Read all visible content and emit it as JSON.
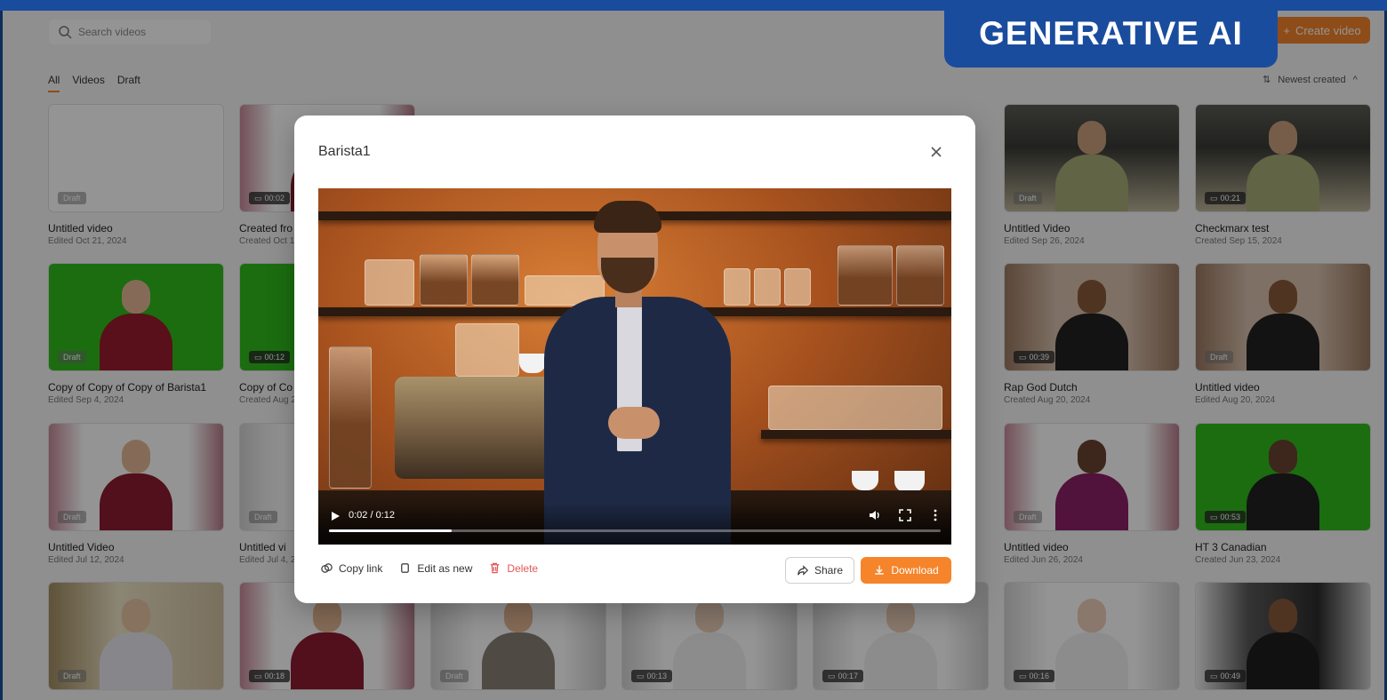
{
  "search": {
    "placeholder": "Search videos"
  },
  "header": {
    "create_label": "Create video"
  },
  "filters": {
    "all": "All",
    "videos": "Videos",
    "draft": "Draft"
  },
  "sort": {
    "label": "Newest created"
  },
  "banner": {
    "text": "GENERATIVE AI"
  },
  "cards": [
    {
      "title": "Untitled video",
      "meta": "Edited Oct 21, 2024",
      "badge": "Draft"
    },
    {
      "title": "Created fro",
      "meta": "Created Oct 1",
      "badge": "00:02"
    },
    {
      "title": "Untitled Video",
      "meta": "Edited Sep 26, 2024",
      "badge": "Draft"
    },
    {
      "title": "Checkmarx test",
      "meta": "Created Sep 15, 2024",
      "badge": "00:21"
    },
    {
      "title": "Copy of Copy of Copy of Barista1",
      "meta": "Edited Sep 4, 2024",
      "badge": "Draft"
    },
    {
      "title": "Copy of Co",
      "meta": "Created Aug 2",
      "badge": "00:12"
    },
    {
      "title": "Rap God Dutch",
      "meta": "Created Aug 20, 2024",
      "badge": "00:39"
    },
    {
      "title": "Untitled video",
      "meta": "Edited Aug 20, 2024",
      "badge": "Draft"
    },
    {
      "title": "Untitled Video",
      "meta": "Edited Jul 12, 2024",
      "badge": "Draft"
    },
    {
      "title": "Untitled vi",
      "meta": "Edited Jul 4, 2",
      "badge": "Draft"
    },
    {
      "title": "Untitled video",
      "meta": "Edited Jun 26, 2024",
      "badge": "Draft"
    },
    {
      "title": "HT 3 Canadian",
      "meta": "Created Jun 23, 2024",
      "badge": "00:53"
    },
    {
      "badge": "Draft"
    },
    {
      "badge": "00:18"
    },
    {
      "badge": "Draft"
    },
    {
      "badge": "00:13"
    },
    {
      "badge": "00:17"
    },
    {
      "badge": "00:16"
    },
    {
      "badge": "00:49"
    }
  ],
  "modal": {
    "title": "Barista1",
    "player": {
      "time": "0:02 / 0:12",
      "progress": 0.2
    },
    "copy_link": "Copy link",
    "edit_as_new": "Edit as new",
    "delete": "Delete",
    "share": "Share",
    "download": "Download"
  },
  "colors": {
    "accent": "#f5842a",
    "brand": "#1a4c9e",
    "danger": "#e25757"
  }
}
